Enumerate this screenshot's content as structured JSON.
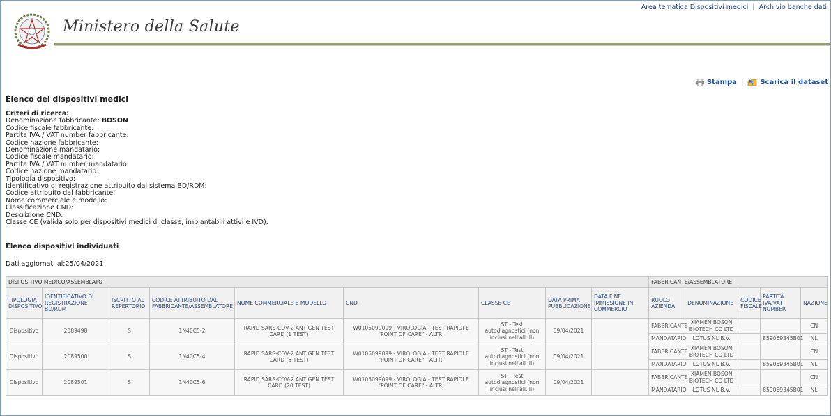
{
  "header": {
    "link_area": "Area tematica Dispositivi medici",
    "link_sep": "|",
    "link_archive": "Archivio banche dati",
    "ministry_name": "Ministero della Salute"
  },
  "actions": {
    "print": "Stampa",
    "sep": "|",
    "download": "Scarica il dataset"
  },
  "page_title": "Elenco dei dispositivi medici",
  "criteria": {
    "heading": "Criteri di ricerca:",
    "rows": [
      {
        "label": "Denominazione fabbricante:",
        "value": "BOSON"
      },
      {
        "label": "Codice fiscale fabbricante:",
        "value": ""
      },
      {
        "label": "Partita IVA / VAT number fabbricante:",
        "value": ""
      },
      {
        "label": "Codice nazione fabbricante:",
        "value": ""
      },
      {
        "label": "Denominazione mandatario:",
        "value": ""
      },
      {
        "label": "Codice fiscale mandatario:",
        "value": ""
      },
      {
        "label": "Partita IVA / VAT number mandatario:",
        "value": ""
      },
      {
        "label": "Codice nazione mandatario:",
        "value": ""
      },
      {
        "label": "Tipologia dispositivo:",
        "value": ""
      },
      {
        "label": "Identificativo di registrazione attribuito dal sistema BD/RDM:",
        "value": ""
      },
      {
        "label": "Codice attribuito dal fabbricante:",
        "value": ""
      },
      {
        "label": "Nome commerciale e modello:",
        "value": ""
      },
      {
        "label": "Classificazione CND:",
        "value": ""
      },
      {
        "label": "Descrizione CND:",
        "value": ""
      },
      {
        "label": "Classe CE (valida solo per dispositivi medici di classe, impiantabili attivi e IVD):",
        "value": ""
      }
    ]
  },
  "results": {
    "title": "Elenco dispositivi individuati",
    "updated": "Dati aggiornati al:25/04/2021",
    "group_device": "DISPOSITIVO MEDICO/ASSEMBLATO",
    "group_maker": "FABBRICANTE/ASSEMBLATORE",
    "columns": [
      "TIPOLOGIA DISPOSITIVO",
      "IDENTIFICATIVO DI REGISTRAZIONE BD/RDM",
      "ISCRITTO AL REPERTORIO",
      "CODICE ATTRIBUITO DAL FABBRICANTE/ASSEMBLATORE",
      "NOME COMMERCIALE E MODELLO",
      "CND",
      "CLASSE CE",
      "DATA PRIMA PUBBLICAZIONE",
      "DATA FINE IMMISSIONE IN COMMERCIO",
      "RUOLO AZIENDA",
      "DENOMINAZIONE",
      "CODICE FISCALE",
      "PARTITA IVA/VAT NUMBER",
      "NAZIONE"
    ],
    "rows": [
      {
        "tipologia": "Dispositivo",
        "id": "2089498",
        "iscritto": "S",
        "codice": "1N40C5-2",
        "nome": "RAPID SARS-COV-2 ANTIGEN TEST CARD (1 TEST)",
        "cnd": "W0105099099 - VIROLOGIA - TEST RAPIDI E \"POINT OF CARE\" - ALTRI",
        "classe": "ST - Test autodiagnostici (non inclusi nell'all. II)",
        "data_pub": "09/04/2021",
        "data_fine": "",
        "fab_ruolo": "FABBRICANTE",
        "fab_den": "XIAMEN BOSON BIOTECH CO LTD",
        "fab_cf": "",
        "fab_piva": "",
        "fab_naz": "CN",
        "man_ruolo": "MANDATARIO",
        "man_den": "LOTUS NL B.V.",
        "man_cf": "",
        "man_piva": "859069345B01",
        "man_naz": "NL"
      },
      {
        "tipologia": "Dispositivo",
        "id": "2089500",
        "iscritto": "S",
        "codice": "1N40C5-4",
        "nome": "RAPID SARS-COV-2 ANTIGEN TEST CARD (5 TEST)",
        "cnd": "W0105099099 - VIROLOGIA - TEST RAPIDI E \"POINT OF CARE\" - ALTRI",
        "classe": "ST - Test autodiagnostici (non inclusi nell'all. II)",
        "data_pub": "09/04/2021",
        "data_fine": "",
        "fab_ruolo": "FABBRICANTE",
        "fab_den": "XIAMEN BOSON BIOTECH CO LTD",
        "fab_cf": "",
        "fab_piva": "",
        "fab_naz": "CN",
        "man_ruolo": "MANDATARIO",
        "man_den": "LOTUS NL B.V.",
        "man_cf": "",
        "man_piva": "859069345B01",
        "man_naz": "NL"
      },
      {
        "tipologia": "Dispositivo",
        "id": "2089501",
        "iscritto": "S",
        "codice": "1N40C5-6",
        "nome": "RAPID SARS-COV-2 ANTIGEN TEST CARD (20 TEST)",
        "cnd": "W0105099099 - VIROLOGIA - TEST RAPIDI E \"POINT OF CARE\" - ALTRI",
        "classe": "ST - Test autodiagnostici (non inclusi nell'all. II)",
        "data_pub": "09/04/2021",
        "data_fine": "",
        "fab_ruolo": "FABBRICANTE",
        "fab_den": "XIAMEN BOSON BIOTECH CO LTD",
        "fab_cf": "",
        "fab_piva": "",
        "fab_naz": "CN",
        "man_ruolo": "MANDATARIO",
        "man_den": "LOTUS NL B.V.",
        "man_cf": "",
        "man_piva": "859069345B01",
        "man_naz": "NL"
      }
    ]
  },
  "icons": {
    "emblem": "italian-republic-emblem-icon",
    "print": "printer-icon",
    "download": "download-dataset-icon"
  },
  "colors": {
    "link": "#1a4e9a",
    "header_rule": "#8fa06a",
    "table_border": "#c6c6c6"
  }
}
